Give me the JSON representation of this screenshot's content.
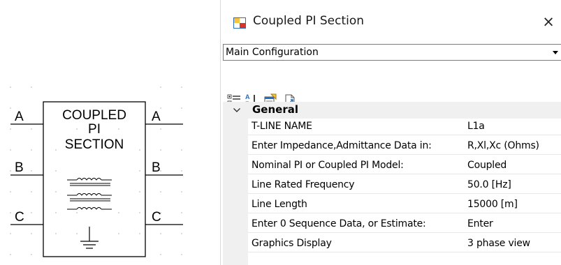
{
  "schematic": {
    "title_lines": [
      "COUPLED",
      "PI",
      "SECTION"
    ],
    "left_pins": [
      "A",
      "B",
      "C"
    ],
    "right_pins": [
      "A",
      "B",
      "C"
    ]
  },
  "window": {
    "title": "Coupled PI Section",
    "close_glyph": "×"
  },
  "config_select": {
    "selected": "Main Configuration"
  },
  "toolbar": {
    "icons": [
      "categorized-icon",
      "alphabetical-sort-icon",
      "property-pages-icon",
      "export-icon"
    ]
  },
  "grid": {
    "category": "General",
    "rows": [
      {
        "name": "T-LINE NAME",
        "value": "L1a"
      },
      {
        "name": "Enter Impedance,Admittance Data in:",
        "value": "R,Xl,Xc (Ohms)"
      },
      {
        "name": "Nominal PI or Coupled PI Model:",
        "value": "Coupled"
      },
      {
        "name": "Line Rated Frequency",
        "value": "50.0 [Hz]"
      },
      {
        "name": "Line Length",
        "value": "15000 [m]"
      },
      {
        "name": "Enter 0 Sequence Data, or Estimate:",
        "value": "Enter"
      },
      {
        "name": "Graphics Display",
        "value": "3 phase view"
      }
    ]
  },
  "colors": {
    "gutter": "#f0f0f0",
    "grid_line": "#e8e8e8",
    "icon_red": "#d9342b",
    "icon_blue": "#1f6fc5"
  }
}
